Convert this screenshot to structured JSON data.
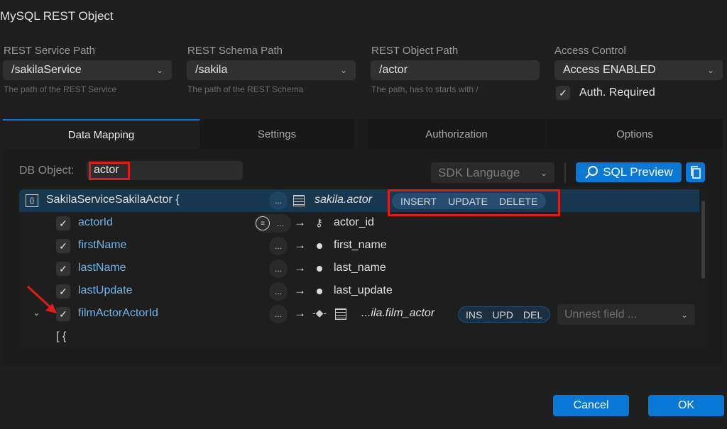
{
  "window": {
    "title": "MySQL REST Object"
  },
  "fields": [
    {
      "label": "REST Service Path",
      "value": "/sakilaService",
      "hint": "The path of the REST Service"
    },
    {
      "label": "REST Schema Path",
      "value": "/sakila",
      "hint": "The path of the REST Schema"
    },
    {
      "label": "REST Object Path",
      "value": "/actor",
      "hint": "The path, has to starts with /"
    },
    {
      "label": "Access Control",
      "value": "Access ENABLED"
    }
  ],
  "auth": {
    "label": "Auth. Required",
    "checked": true
  },
  "tabs": [
    "Data Mapping",
    "Settings",
    "Authorization",
    "Options"
  ],
  "db_object": {
    "label": "DB Object:",
    "value": "actor"
  },
  "toolbar": {
    "sdk_placeholder": "SDK Language",
    "sql_preview": "SQL Preview"
  },
  "tree": {
    "root": {
      "name": "SakilaServiceSakilaActor {",
      "dots": "...",
      "table": "sakila.actor",
      "ops": [
        "INSERT",
        "UPDATE",
        "DELETE"
      ]
    },
    "rows": [
      {
        "name": "actorId",
        "column": "actor_id",
        "dots": "..."
      },
      {
        "name": "firstName",
        "column": "first_name",
        "dots": "..."
      },
      {
        "name": "lastName",
        "column": "last_name",
        "dots": "..."
      },
      {
        "name": "lastUpdate",
        "column": "last_update",
        "dots": "..."
      }
    ],
    "nested": {
      "name": "filmActorActorId",
      "dots": "...",
      "table": "...ila.film_actor",
      "ops": [
        "INS",
        "UPD",
        "DEL"
      ],
      "unnest_placeholder": "Unnest field ..."
    },
    "bracket": "[ {"
  },
  "footer": {
    "cancel": "Cancel",
    "ok": "OK"
  },
  "colors": {
    "accent": "#0a78d7",
    "highlight": "#e01b1b",
    "row_selected": "#183850"
  }
}
